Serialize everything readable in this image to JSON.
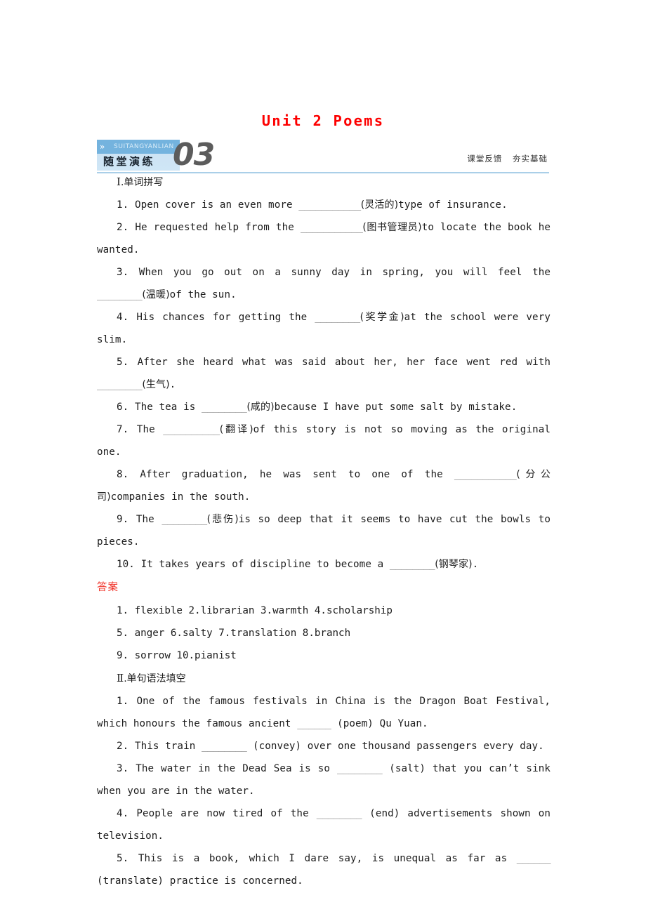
{
  "document": {
    "title": "Unit 2 Poems"
  },
  "banner": {
    "pin_icon": "»",
    "pinyin": "SUITANGYANLIAN",
    "chinese_label": "随堂演练",
    "number": "03",
    "tag_left": "课堂反馈",
    "tag_right": "夯实基础",
    "accent_color": "#74b3de",
    "accent_light": "#cfe6f6",
    "rule_color": "#aacfe8",
    "number_color": "#5c5c5c"
  },
  "sections": [
    {
      "numeral": "Ⅰ",
      "heading": ".单词拼写",
      "questions": [
        {
          "num": "1.",
          "parts": [
            {
              "t": "en",
              "v": " Open cover is an even more "
            },
            {
              "t": "blank",
              "v": "___________"
            },
            {
              "t": "cn",
              "v": "(灵活的)"
            },
            {
              "t": "en",
              "v": "type of insurance."
            }
          ]
        },
        {
          "num": "2.",
          "parts": [
            {
              "t": "en",
              "v": " He requested help from the "
            },
            {
              "t": "blank",
              "v": "___________"
            },
            {
              "t": "cn",
              "v": "(图书管理员)"
            },
            {
              "t": "en",
              "v": "to locate the book he wanted."
            }
          ]
        },
        {
          "num": "3.",
          "parts": [
            {
              "t": "en",
              "v": " When you go out on a sunny day in spring, you will feel the "
            },
            {
              "t": "blank",
              "v": "________"
            },
            {
              "t": "cn",
              "v": "(温暖)"
            },
            {
              "t": "en",
              "v": "of the sun."
            }
          ]
        },
        {
          "num": "4.",
          "parts": [
            {
              "t": "en",
              "v": " His chances for getting the "
            },
            {
              "t": "blank",
              "v": "________"
            },
            {
              "t": "cn",
              "v": "(奖学金)"
            },
            {
              "t": "en",
              "v": "at the school were very slim."
            }
          ]
        },
        {
          "num": "5.",
          "parts": [
            {
              "t": "en",
              "v": " After she heard what was said about her, her face went red with "
            },
            {
              "t": "blank",
              "v": "________"
            },
            {
              "t": "cn",
              "v": "(生气)"
            },
            {
              "t": "en",
              "v": "."
            }
          ]
        },
        {
          "num": "6.",
          "parts": [
            {
              "t": "en",
              "v": " The tea is "
            },
            {
              "t": "blank",
              "v": "________"
            },
            {
              "t": "cn",
              "v": "(咸的)"
            },
            {
              "t": "en",
              "v": "because I have put some salt by mistake."
            }
          ]
        },
        {
          "num": "7.",
          "parts": [
            {
              "t": "en",
              "v": " The "
            },
            {
              "t": "blank",
              "v": "__________"
            },
            {
              "t": "cn",
              "v": "(翻译)"
            },
            {
              "t": "en",
              "v": "of this story is not so moving as the original one."
            }
          ]
        },
        {
          "num": "8.",
          "parts": [
            {
              "t": "en",
              "v": " After graduation, he was sent to one of the "
            },
            {
              "t": "blank",
              "v": "___________"
            },
            {
              "t": "cn",
              "v": "(分公司)"
            },
            {
              "t": "en",
              "v": "companies in the south."
            }
          ]
        },
        {
          "num": "9.",
          "parts": [
            {
              "t": "en",
              "v": " The "
            },
            {
              "t": "blank",
              "v": "________"
            },
            {
              "t": "cn",
              "v": "(悲伤)"
            },
            {
              "t": "en",
              "v": "is so deep that it seems to have cut the bowls to pieces."
            }
          ]
        },
        {
          "num": "10.",
          "parts": [
            {
              "t": "en",
              "v": " It takes years of discipline to become a "
            },
            {
              "t": "blank",
              "v": "________"
            },
            {
              "t": "cn",
              "v": "(钢琴家)"
            },
            {
              "t": "en",
              "v": "."
            }
          ]
        }
      ],
      "answer_title": "答案",
      "answer_lines": [
        "1. flexible  2.librarian  3.warmth  4.scholarship",
        "5. anger  6.salty  7.translation  8.branch",
        "9. sorrow  10.pianist"
      ]
    },
    {
      "numeral": "Ⅱ",
      "heading": ".单句语法填空",
      "questions": [
        {
          "num": "1.",
          "parts": [
            {
              "t": "en",
              "v": " One of the famous festivals in China is the Dragon Boat Festival, which honours the famous ancient "
            },
            {
              "t": "blank",
              "v": "______"
            },
            {
              "t": "en",
              "v": " (poem) Qu Yuan."
            }
          ]
        },
        {
          "num": "2.",
          "parts": [
            {
              "t": "en",
              "v": " This train "
            },
            {
              "t": "blank",
              "v": "________"
            },
            {
              "t": "en",
              "v": " (convey) over one thousand passengers every day."
            }
          ]
        },
        {
          "num": "3.",
          "parts": [
            {
              "t": "en",
              "v": " The water in the Dead Sea is so "
            },
            {
              "t": "blank",
              "v": "________"
            },
            {
              "t": "en",
              "v": " (salt) that you can’t sink when you are in the water."
            }
          ]
        },
        {
          "num": "4.",
          "parts": [
            {
              "t": "en",
              "v": " People are now tired of the "
            },
            {
              "t": "blank",
              "v": "________"
            },
            {
              "t": "en",
              "v": " (end) advertisements shown on television."
            }
          ]
        },
        {
          "num": "5.",
          "parts": [
            {
              "t": "en",
              "v": " This is a book, which I dare say, is unequal as far as "
            },
            {
              "t": "blank",
              "v": "______"
            },
            {
              "t": "en",
              "v": " (translate) practice  is concerned."
            }
          ]
        }
      ]
    }
  ]
}
